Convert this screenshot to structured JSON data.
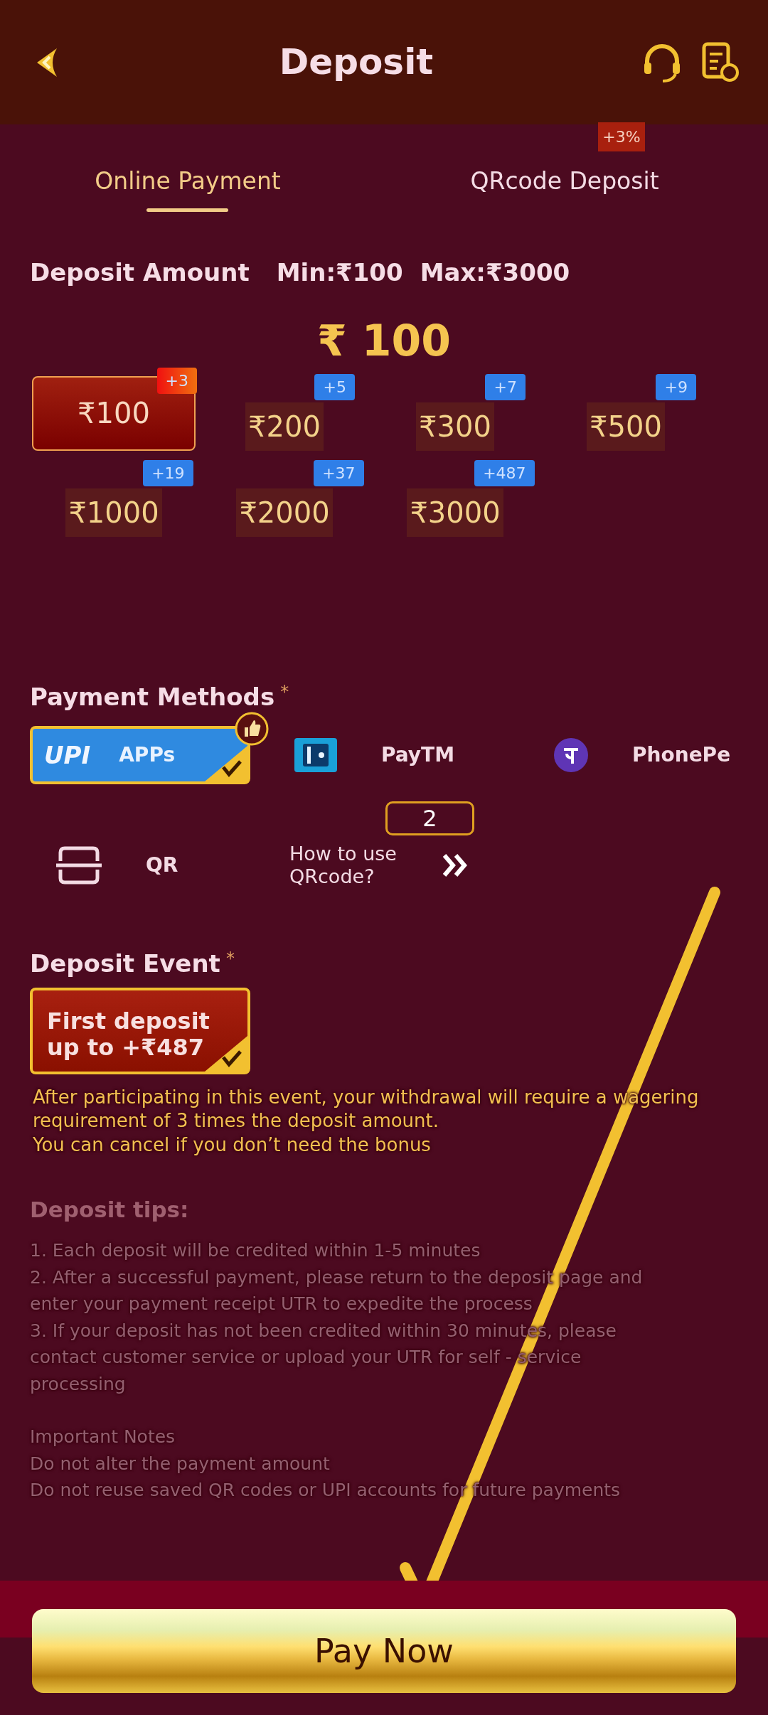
{
  "header": {
    "title": "Deposit"
  },
  "tabs": [
    {
      "label": "Online Payment",
      "selected": true
    },
    {
      "label": "QRcode Deposit",
      "selected": false,
      "badge": "+3%"
    }
  ],
  "amount": {
    "label": "Deposit Amount",
    "min": "Min:₹100",
    "max": "Max:₹3000",
    "value": "₹ 100"
  },
  "amount_options": [
    {
      "amount": "₹100",
      "bonus": "+3",
      "selected": true
    },
    {
      "amount": "₹200",
      "bonus": "+5",
      "selected": false
    },
    {
      "amount": "₹300",
      "bonus": "+7",
      "selected": false
    },
    {
      "amount": "₹500",
      "bonus": "+9",
      "selected": false
    },
    {
      "amount": "₹1000",
      "bonus": "+19",
      "selected": false
    },
    {
      "amount": "₹2000",
      "bonus": "+37",
      "selected": false
    },
    {
      "amount": "₹3000",
      "bonus": "+487",
      "selected": false
    }
  ],
  "payment_methods": {
    "label": "Payment Methods",
    "mark": "*",
    "items": [
      {
        "kind": "upi",
        "logo_text": "UPI",
        "label": "APPs",
        "selected": true,
        "recommended": true
      },
      {
        "kind": "paytm",
        "label": "PayTM",
        "selected": false,
        "recommended": false
      },
      {
        "kind": "phonepe",
        "label": "PhonePe",
        "selected": false,
        "recommended": false
      },
      {
        "kind": "qr",
        "label": "QR",
        "selected": false,
        "recommended": false
      }
    ],
    "help": {
      "text": "How to use QRcode?",
      "badge": "2"
    }
  },
  "deposit_event": {
    "label": "Deposit Event",
    "mark": "*",
    "option": {
      "lines": [
        "First deposit",
        "up to +₹487"
      ],
      "selected": true
    },
    "note": [
      "After participating in this event, your withdrawal will require a wagering requirement of 3 times the deposit amount.",
      "You can cancel if you don’t need the bonus"
    ]
  },
  "tips": {
    "title": "Deposit tips:",
    "lines": [
      "1. Each deposit will be credited within 1-5 minutes",
      "2. After a successful payment, please return to the deposit page and enter your payment receipt UTR to expedite the process",
      "3. If your deposit has not been credited within 30 minutes, please contact customer service or upload your UTR for self - service processing"
    ],
    "notes_title": "Important Notes",
    "notes": [
      "Do not alter the payment amount",
      "Do not reuse saved QR codes or UPI accounts for future payments"
    ]
  },
  "pay_button": {
    "label": "Pay Now"
  }
}
